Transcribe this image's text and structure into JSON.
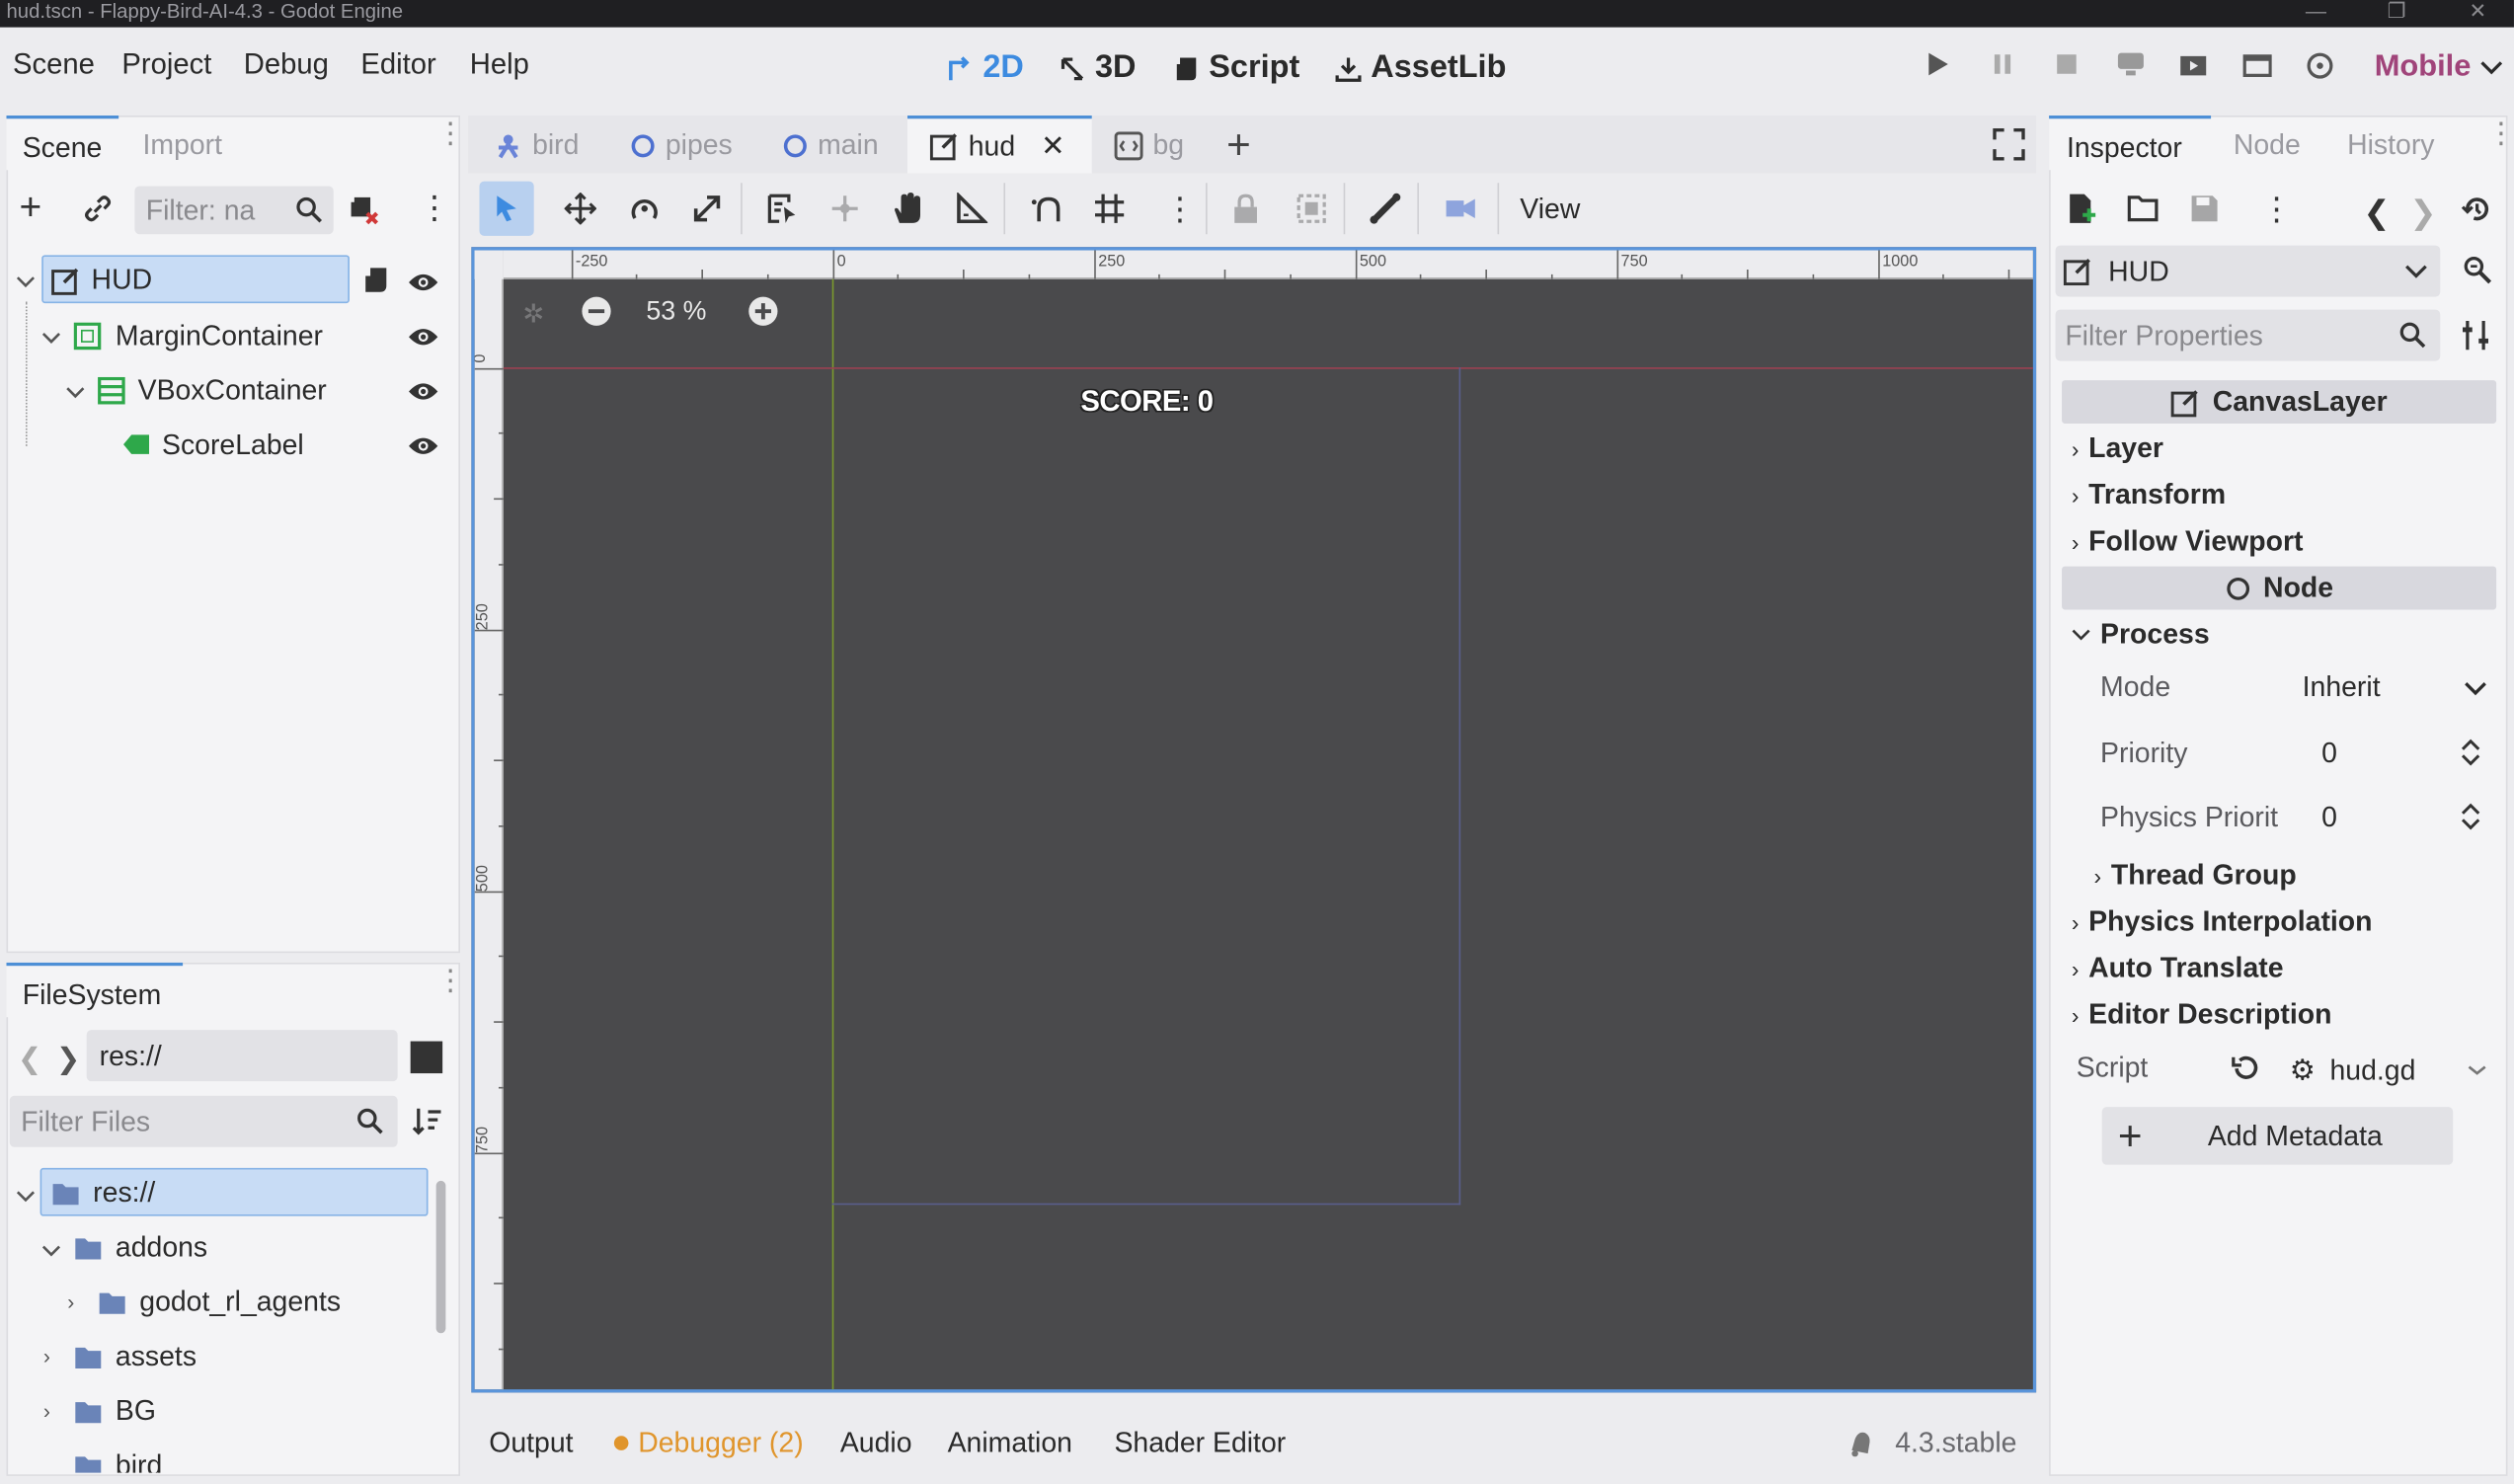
{
  "window": {
    "title": "hud.tscn - Flappy-Bird-AI-4.3 - Godot Engine"
  },
  "menu": [
    "Scene",
    "Project",
    "Debug",
    "Editor",
    "Help"
  ],
  "modes": {
    "m2d": "2D",
    "m3d": "3D",
    "script": "Script",
    "assetlib": "AssetLib"
  },
  "renderer": "Mobile",
  "scene_dock": {
    "tabs": {
      "scene": "Scene",
      "import": "Import"
    },
    "filter_placeholder": "Filter: na",
    "nodes": [
      {
        "name": "HUD",
        "icon": "canvaslayer-icon"
      },
      {
        "name": "MarginContainer",
        "icon": "margincontainer-icon"
      },
      {
        "name": "VBoxContainer",
        "icon": "vboxcontainer-icon"
      },
      {
        "name": "ScoreLabel",
        "icon": "label-icon"
      }
    ]
  },
  "filesystem": {
    "tab": "FileSystem",
    "path": "res://",
    "filter_placeholder": "Filter Files",
    "items": [
      {
        "name": "res://"
      },
      {
        "name": "addons"
      },
      {
        "name": "godot_rl_agents"
      },
      {
        "name": "assets"
      },
      {
        "name": "BG"
      },
      {
        "name": "bird"
      }
    ]
  },
  "scene_tabs": [
    "bird",
    "pipes",
    "main",
    "hud",
    "bg"
  ],
  "toolbar": {
    "view": "View"
  },
  "viewport": {
    "zoom": "53 %",
    "ruler_h": [
      "-250",
      "0",
      "250",
      "500",
      "750",
      "1000"
    ],
    "ruler_v": [
      "0",
      "250",
      "500",
      "750"
    ],
    "score_text": "SCORE: 0"
  },
  "bottom_panel": {
    "output": "Output",
    "debugger": "Debugger (2)",
    "audio": "Audio",
    "animation": "Animation",
    "shader": "Shader Editor",
    "version": "4.3.stable"
  },
  "inspector": {
    "tabs": {
      "inspector": "Inspector",
      "node": "Node",
      "history": "History"
    },
    "object": "HUD",
    "filter_placeholder": "Filter Properties",
    "class_header": "CanvasLayer",
    "sections_a": [
      "Layer",
      "Transform",
      "Follow Viewport"
    ],
    "node_header": "Node",
    "process": "Process",
    "mode_label": "Mode",
    "mode_value": "Inherit",
    "priority_label": "Priority",
    "priority_value": "0",
    "physics_label": "Physics Priorit",
    "physics_value": "0",
    "thread_group": "Thread Group",
    "sections_b": [
      "Physics Interpolation",
      "Auto Translate",
      "Editor Description"
    ],
    "script_label": "Script",
    "script_value": "hud.gd",
    "add_metadata": "Add Metadata"
  },
  "colors": {
    "accent": "#4d8fd6",
    "viewport": "#4a4a4c",
    "debugger": "#e0952c",
    "renderer": "#a0447a"
  }
}
